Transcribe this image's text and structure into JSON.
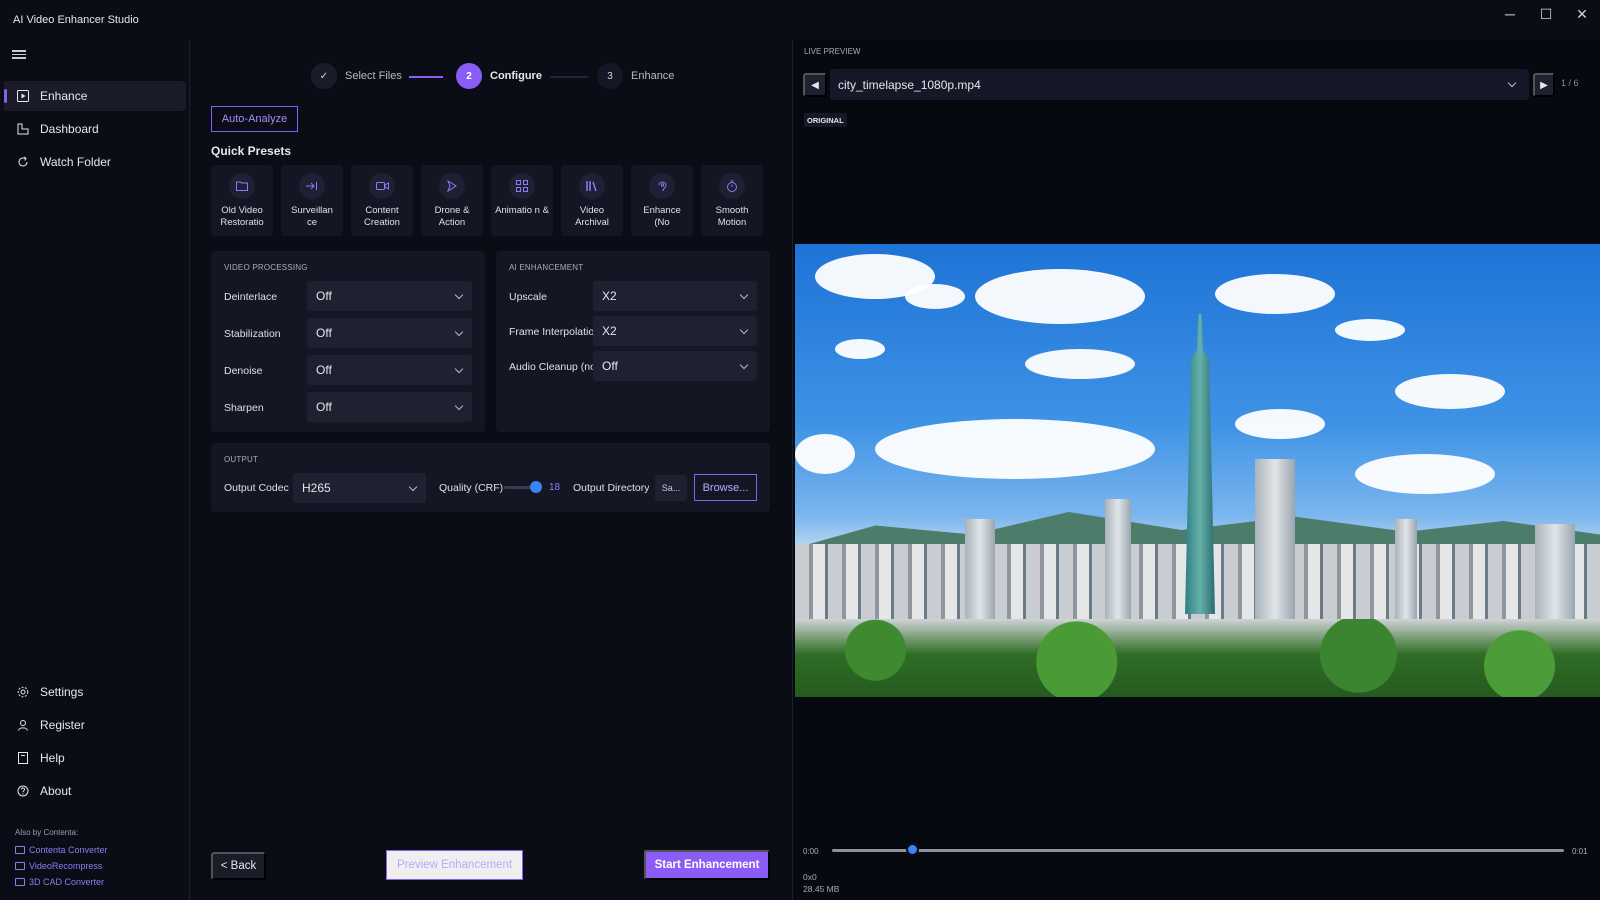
{
  "app": {
    "title": "AI Video Enhancer Studio"
  },
  "window": {
    "minimize": "─",
    "maximize": "☐",
    "close": "✕"
  },
  "sidebar": {
    "items": [
      {
        "label": "Enhance",
        "icon": "play-square-icon",
        "active": true
      },
      {
        "label": "Dashboard",
        "icon": "dashboard-icon",
        "active": false
      },
      {
        "label": "Watch Folder",
        "icon": "refresh-icon",
        "active": false
      }
    ],
    "bottom_items": [
      {
        "label": "Settings",
        "icon": "gear-icon"
      },
      {
        "label": "Register",
        "icon": "user-icon"
      },
      {
        "label": "Help",
        "icon": "book-icon"
      },
      {
        "label": "About",
        "icon": "question-circle-icon"
      }
    ],
    "also_by": "Also by Contenta:",
    "links": [
      "Contenta Converter",
      "VideoRecompress",
      "3D CAD Converter"
    ]
  },
  "stepper": {
    "steps": [
      {
        "number": "✓",
        "label": "Select Files",
        "state": "done"
      },
      {
        "number": "2",
        "label": "Configure",
        "state": "active"
      },
      {
        "number": "3",
        "label": "Enhance",
        "state": "todo"
      }
    ]
  },
  "auto_analyze": "Auto-Analyze",
  "quick_presets": {
    "title": "Quick Presets",
    "items": [
      {
        "label": "Old Video Restoratio",
        "icon": "folder-icon"
      },
      {
        "label": "Surveillan ce",
        "icon": "arrow-right-bar-icon"
      },
      {
        "label": "Content Creation",
        "icon": "camera-icon"
      },
      {
        "label": "Drone & Action",
        "icon": "drone-icon"
      },
      {
        "label": "Animatio n &",
        "icon": "grid-icon"
      },
      {
        "label": "Video Archival",
        "icon": "library-icon"
      },
      {
        "label": "Enhance (No",
        "icon": "ear-icon"
      },
      {
        "label": "Smooth Motion",
        "icon": "timer-icon"
      }
    ]
  },
  "video_processing": {
    "title": "VIDEO PROCESSING",
    "fields": [
      {
        "label": "Deinterlace",
        "value": "Off"
      },
      {
        "label": "Stabilization",
        "value": "Off"
      },
      {
        "label": "Denoise",
        "value": "Off"
      },
      {
        "label": "Sharpen",
        "value": "Off"
      }
    ]
  },
  "ai_enhancement": {
    "title": "AI ENHANCEMENT",
    "fields": [
      {
        "label": "Upscale",
        "value": "X2"
      },
      {
        "label": "Frame Interpolation",
        "value": "X2"
      },
      {
        "label": "Audio Cleanup (no",
        "value": "Off"
      }
    ]
  },
  "output": {
    "title": "OUTPUT",
    "codec_label": "Output Codec",
    "codec_value": "H265",
    "quality_label": "Quality (CRF)",
    "quality_value": "18",
    "dir_label": "Output Directory",
    "dir_value": "Sa...",
    "browse": "Browse..."
  },
  "footer": {
    "back": "< Back",
    "preview": "Preview Enhancement",
    "start": "Start Enhancement"
  },
  "preview": {
    "title": "LIVE PREVIEW",
    "prev": "◀",
    "next": "▶",
    "file": "city_timelapse_1080p.mp4",
    "counter": "1 / 6",
    "badge": "ORIGINAL",
    "time_start": "0:00",
    "time_end": "0:01",
    "scrub_position": 0.1,
    "resolution": "0x0",
    "size": "28.45 MB"
  },
  "colors": {
    "accent": "#8b5cf6",
    "slider": "#3b82f6",
    "background": "#0b0d16",
    "panel": "#141723"
  }
}
